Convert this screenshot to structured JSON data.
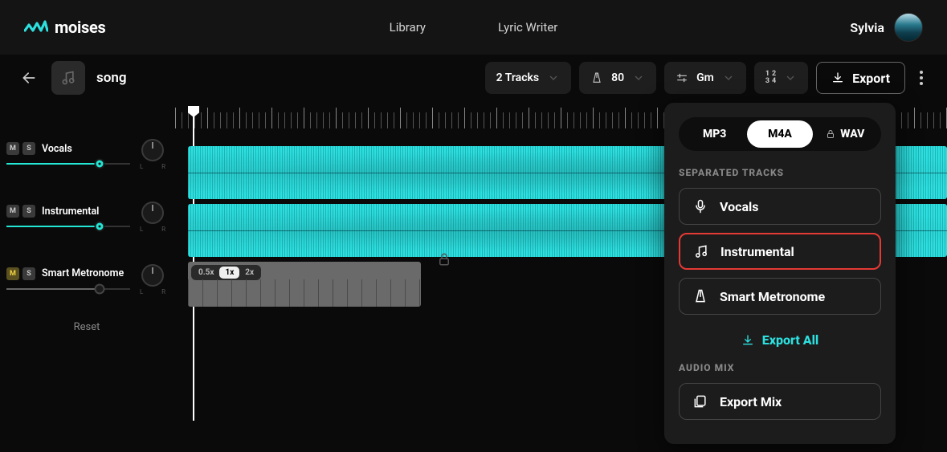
{
  "brand": "moises",
  "nav": {
    "library": "Library",
    "lyric_writer": "Lyric Writer"
  },
  "user": {
    "name": "Sylvia"
  },
  "song": {
    "title": "song"
  },
  "toolbar": {
    "tracks": "2 Tracks",
    "tempo": "80",
    "key": "Gm",
    "time_sig": {
      "a": "1",
      "b": "2",
      "c": "3",
      "d": "4"
    },
    "export": "Export"
  },
  "tracks": {
    "vocals": "Vocals",
    "instrumental": "Instrumental",
    "smart_metronome": "Smart Metronome",
    "reset": "Reset",
    "m": "M",
    "s": "S",
    "l": "L",
    "r": "R"
  },
  "speeds": {
    "half": "0.5x",
    "one": "1x",
    "two": "2x"
  },
  "popover": {
    "mp3": "MP3",
    "m4a": "M4A",
    "wav": "WAV",
    "separated_heading": "SEPARATED TRACKS",
    "vocals": "Vocals",
    "instrumental": "Instrumental",
    "smart_metronome": "Smart Metronome",
    "export_all": "Export All",
    "audio_mix_heading": "AUDIO MIX",
    "export_mix": "Export Mix"
  }
}
